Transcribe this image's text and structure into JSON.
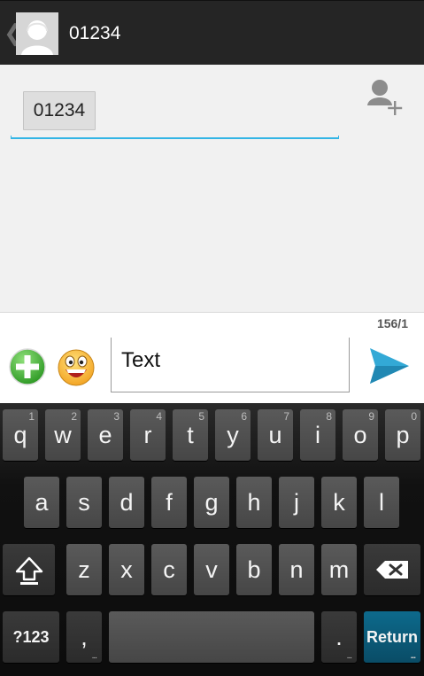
{
  "header": {
    "back_glyph": "❮",
    "avatar_icon": "contact-avatar-icon",
    "title": "01234"
  },
  "recipients": {
    "chips": [
      "01234"
    ],
    "add_contact_icon": "add-person-icon"
  },
  "compose": {
    "counter": "156/1",
    "message_text": "Text",
    "attach_icon": "green-plus-icon",
    "emoji_icon": "smiley-icon",
    "send_icon": "send-arrow-icon"
  },
  "keyboard": {
    "row1": [
      {
        "label": "q",
        "hint": "1"
      },
      {
        "label": "w",
        "hint": "2"
      },
      {
        "label": "e",
        "hint": "3"
      },
      {
        "label": "r",
        "hint": "4"
      },
      {
        "label": "t",
        "hint": "5"
      },
      {
        "label": "y",
        "hint": "6"
      },
      {
        "label": "u",
        "hint": "7"
      },
      {
        "label": "i",
        "hint": "8"
      },
      {
        "label": "o",
        "hint": "9"
      },
      {
        "label": "p",
        "hint": "0"
      }
    ],
    "row2": [
      "a",
      "s",
      "d",
      "f",
      "g",
      "h",
      "j",
      "k",
      "l"
    ],
    "row3": [
      "z",
      "x",
      "c",
      "v",
      "b",
      "n",
      "m"
    ],
    "symbols_label": "?123",
    "comma_label": ",",
    "period_label": ".",
    "return_label": "Return",
    "more_dots": "..."
  },
  "colors": {
    "accent": "#33b5e5",
    "action_bar": "#252525",
    "return_key": "#0a5472"
  }
}
